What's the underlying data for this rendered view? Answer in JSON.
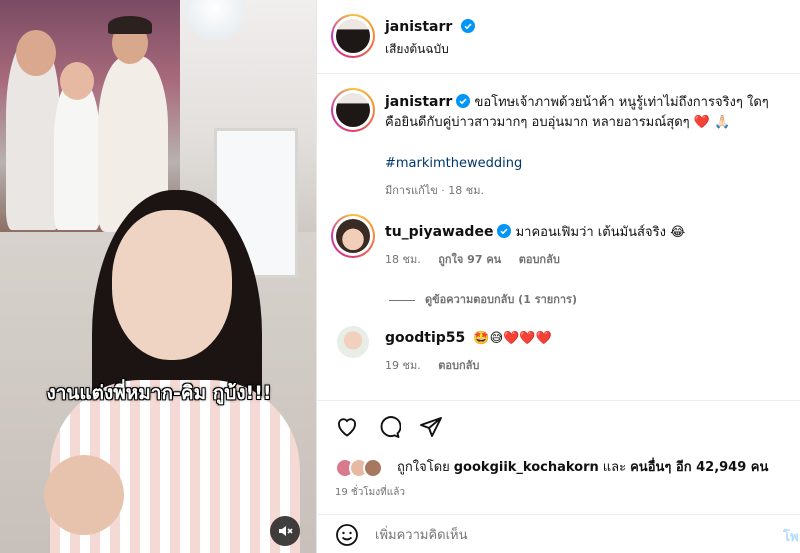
{
  "post": {
    "video_caption": "งานแต่งพี่หมาก-คิม กูบ้ง!!!"
  },
  "header": {
    "username": "janistarr",
    "audio_label": "เสียงต้นฉบับ"
  },
  "caption": {
    "username": "janistarr",
    "text": "ขอโทษเจ้าภาพด้วยน้าค้า หนูรู้เท่าไม่ถึงการจริงๆ ใดๆคือยินดีกับคู่บ่าวสาวมากๆ อบอุ่นมาก หลายอารมณ์สุดๆ",
    "emojis": "❤️ 🙏🏻",
    "hashtag": "#markimthewedding",
    "meta": "มีการแก้ไข · 18 ชม."
  },
  "comments": [
    {
      "username": "tu_piyawadee",
      "text": "มาคอนเฟิมว่า เต้นมันส์จริง",
      "emoji": "😂",
      "time": "18 ชม.",
      "likes": "ถูกใจ 97 คน",
      "reply": "ตอบกลับ",
      "view_replies": "ดูข้อความตอบกลับ (1 รายการ)"
    },
    {
      "username": "goodtip55",
      "emojis": "🤩😅❤️❤️❤️",
      "time": "19 ชม.",
      "reply": "ตอบกลับ"
    }
  ],
  "likes": {
    "prefix": "ถูกใจโดย",
    "user": "gookgiik_kochakorn",
    "conj": "และ",
    "others": "คนอื่นๆ อีก 42,949 คน",
    "time": "19 ชั่วโมงที่แล้ว"
  },
  "comment_input": {
    "placeholder": "เพิ่มความคิดเห็น",
    "post_label": "โพ"
  },
  "colors": {
    "verified": "#0095f6",
    "link": "#00376b",
    "muted": "#737373"
  }
}
